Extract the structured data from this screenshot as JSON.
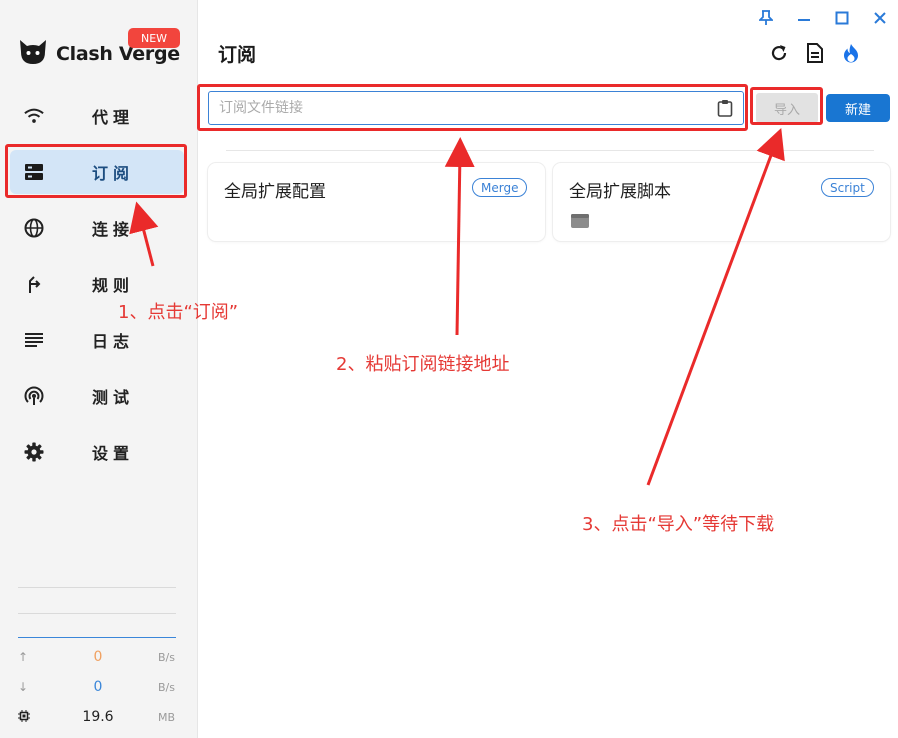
{
  "app": {
    "name": "Clash Verge",
    "new_badge": "NEW"
  },
  "sidebar": {
    "items": [
      {
        "label": "代理",
        "icon": "wifi-icon"
      },
      {
        "label": "订阅",
        "icon": "dns-icon",
        "active": true
      },
      {
        "label": "连接",
        "icon": "globe-icon"
      },
      {
        "label": "规则",
        "icon": "fork-icon"
      },
      {
        "label": "日志",
        "icon": "subject-icon"
      },
      {
        "label": "测试",
        "icon": "radar-icon"
      },
      {
        "label": "设置",
        "icon": "gear-icon"
      }
    ],
    "traffic": {
      "upload": {
        "value": "0",
        "unit": "B/s",
        "color": "#f0a060"
      },
      "download": {
        "value": "0",
        "unit": "B/s",
        "color": "#3a86d9"
      },
      "memory": {
        "value": "19.6",
        "unit": "MB"
      }
    }
  },
  "main": {
    "title": "订阅",
    "url_input": {
      "placeholder": "订阅文件链接",
      "value": ""
    },
    "import_label": "导入",
    "new_label": "新建",
    "cards": [
      {
        "title": "全局扩展配置",
        "chip": "Merge"
      },
      {
        "title": "全局扩展脚本",
        "chip": "Script"
      }
    ]
  },
  "annotations": {
    "step1": "1、点击“订阅”",
    "step2": "2、粘贴订阅链接地址",
    "step3": "3、点击“导入”等待下载"
  },
  "colors": {
    "accent": "#1976d2",
    "annotation": "#e53935",
    "active_bg": "#d3e5f7"
  }
}
